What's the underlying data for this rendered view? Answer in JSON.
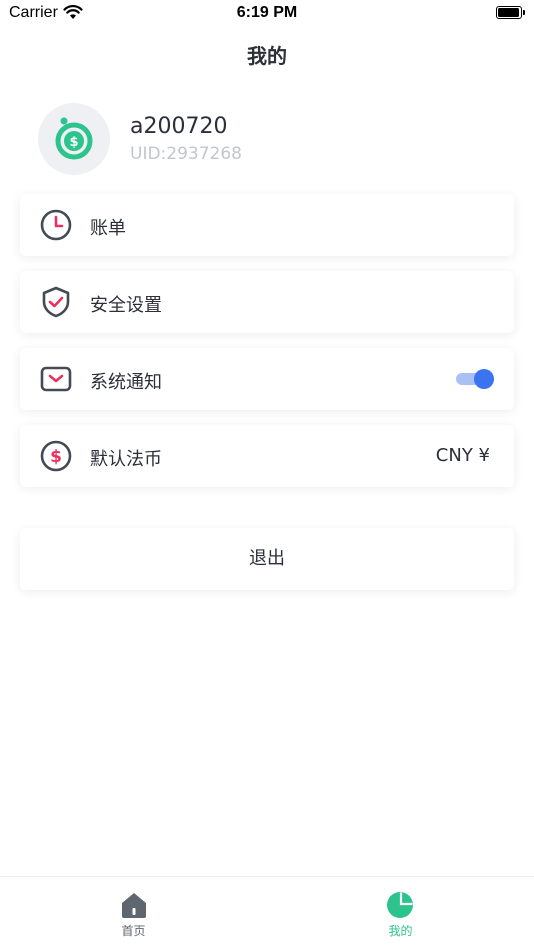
{
  "status_bar": {
    "carrier": "Carrier",
    "time": "6:19 PM"
  },
  "header": {
    "title": "我的"
  },
  "profile": {
    "username": "a200720",
    "uid": "UID:2937268"
  },
  "menu": {
    "bill": {
      "label": "账单",
      "icon": "clock-icon"
    },
    "security": {
      "label": "安全设置",
      "icon": "shield-icon"
    },
    "notifications": {
      "label": "系统通知",
      "icon": "mail-icon",
      "enabled": true
    },
    "currency": {
      "label": "默认法币",
      "icon": "dollar-icon",
      "value": "CNY ¥"
    }
  },
  "logout": {
    "label": "退出"
  },
  "tabbar": {
    "home": {
      "label": "首页",
      "icon": "home-icon"
    },
    "mine": {
      "label": "我的",
      "icon": "pie-chart-icon",
      "active": true
    }
  },
  "colors": {
    "accent_green": "#2cc38d",
    "accent_blue": "#3b74f0",
    "icon_red": "#e8345d",
    "icon_gray": "#454b55"
  }
}
